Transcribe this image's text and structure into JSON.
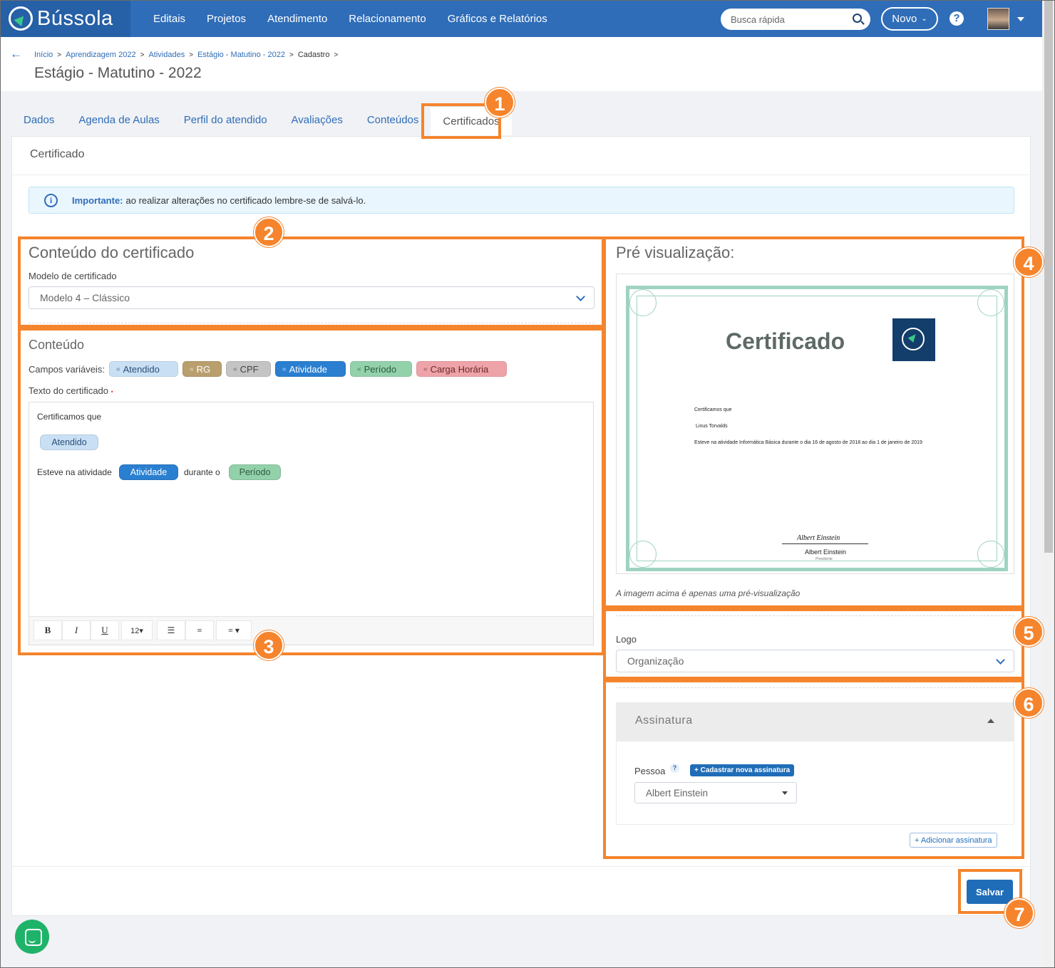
{
  "brand": {
    "name": "Bússola"
  },
  "nav": {
    "items": [
      "Editais",
      "Projetos",
      "Atendimento",
      "Relacionamento",
      "Gráficos e Relatórios"
    ]
  },
  "search": {
    "placeholder": "Busca rápida"
  },
  "header": {
    "novo_label": "Novo",
    "help_label": "?",
    "breadcrumb": [
      "Início",
      "Aprendizagem 2022",
      "Atividades",
      "Estágio - Matutino - 2022",
      "Cadastro"
    ],
    "title": "Estágio - Matutino - 2022"
  },
  "tabs": [
    "Dados",
    "Agenda de Aulas",
    "Perfil do atendido",
    "Avaliações",
    "Conteúdos",
    "Certificados"
  ],
  "card": {
    "title": "Certificado"
  },
  "alert": {
    "icon": "info-icon",
    "strong": "Importante:",
    "text": "ao realizar alterações no certificado lembre-se de salvá-lo."
  },
  "content_section": {
    "title": "Conteúdo do certificado",
    "model_label": "Modelo de certificado",
    "model_value": "Modelo 4 – Clássico"
  },
  "conteudo": {
    "title": "Conteúdo",
    "fields_label": "Campos variáveis:",
    "chips": [
      {
        "label": "Atendido",
        "color": "#c9e0f4"
      },
      {
        "label": "RG",
        "color": "#b99f6e"
      },
      {
        "label": "CPF",
        "color": "#c4c4c4"
      },
      {
        "label": "Atividade",
        "color": "#2a7fd0"
      },
      {
        "label": "Período",
        "color": "#93d1ab"
      },
      {
        "label": "Carga Horária",
        "color": "#eea3a8"
      }
    ],
    "text_label": "Texto do certificado",
    "required_mark": "•",
    "editor": {
      "line1": "Certificamos que",
      "token_atendido": "Atendido",
      "line3_prefix": "Esteve na atividade",
      "token_atividade": "Atividade",
      "line3_middle": "durante o",
      "token_periodo": "Período"
    },
    "toolbar": {
      "bold": "B",
      "italic": "I",
      "underline": "U",
      "size": "12▾",
      "list": "☰",
      "olist": "≡",
      "align": "≡ ▾"
    }
  },
  "preview": {
    "title": "Pré visualização:",
    "cert_title": "Certificado",
    "line1": "Certificamos que",
    "line2": "Linus Torvalds",
    "line3": "Esteve na atividade Informática Básica durante o dia 16 de agosto de 2018 ao dia 1 de janeiro de 2019",
    "signature_script": "Albert Einstein",
    "signer": "Albert Einstein",
    "signer_role": "Presidente",
    "note": "A imagem acima é apenas uma pré-visualização"
  },
  "logo_section": {
    "label": "Logo",
    "value": "Organização"
  },
  "signature_section": {
    "title": "Assinatura",
    "person_label": "Pessoa",
    "help_label": "?",
    "new_button": "+ Cadastrar nova assinatura",
    "person_value": "Albert Einstein",
    "add_button": "+ Adicionar assinatura"
  },
  "save_button": "Salvar",
  "annotations": [
    "1",
    "2",
    "3",
    "4",
    "5",
    "6",
    "7"
  ],
  "colors": {
    "accent": "#2f6db8",
    "highlight": "#f5842c"
  }
}
